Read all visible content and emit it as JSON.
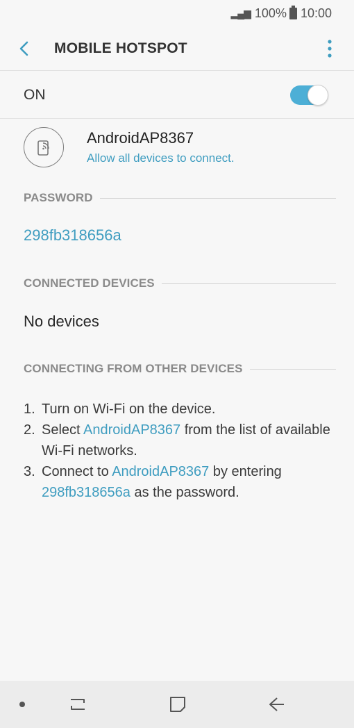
{
  "status_bar": {
    "signal": "▂▄▆",
    "battery": "100%",
    "time": "10:00"
  },
  "app_bar": {
    "title": "MOBILE HOTSPOT"
  },
  "toggle": {
    "label": "ON",
    "state": "on",
    "accent": "#4dafd6"
  },
  "network": {
    "name": "AndroidAP8367",
    "subtitle": "Allow all devices to connect."
  },
  "password": {
    "header": "PASSWORD",
    "value": "298fb318656a"
  },
  "connected": {
    "header": "CONNECTED DEVICES",
    "empty_text": "No devices"
  },
  "connecting": {
    "header": "CONNECTING FROM OTHER DEVICES",
    "step1": {
      "num": "1.",
      "text": "Turn on Wi-Fi on the device."
    },
    "step2": {
      "num": "2.",
      "pre": "Select ",
      "link": "AndroidAP8367",
      "post": " from the list of available Wi-Fi networks."
    },
    "step3": {
      "num": "3.",
      "pre": "Connect to ",
      "link": "AndroidAP8367",
      "mid": " by entering ",
      "link2": "298fb318656a",
      "post": " as the password."
    }
  },
  "colors": {
    "link": "#3f9dc0",
    "background": "#f7f7f7"
  },
  "icons": [
    "back-arrow-icon",
    "more-vert-icon",
    "hotspot-phone-icon",
    "recent-apps-icon",
    "home-icon",
    "back-nav-icon"
  ]
}
